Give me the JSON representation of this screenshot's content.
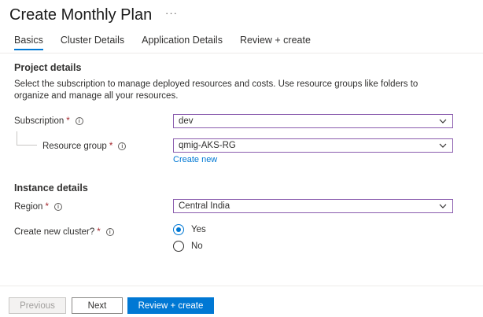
{
  "page": {
    "title": "Create Monthly Plan",
    "more_label": "···"
  },
  "tabs": [
    {
      "label": "Basics",
      "active": true
    },
    {
      "label": "Cluster Details",
      "active": false
    },
    {
      "label": "Application Details",
      "active": false
    },
    {
      "label": "Review + create",
      "active": false
    }
  ],
  "project_details": {
    "heading": "Project details",
    "description": "Select the subscription to manage deployed resources and costs. Use resource groups like folders to organize and manage all your resources.",
    "subscription": {
      "label": "Subscription",
      "required_mark": "*",
      "value": "dev"
    },
    "resource_group": {
      "label": "Resource group",
      "required_mark": "*",
      "value": "qmig-AKS-RG"
    },
    "create_new_link": "Create new"
  },
  "instance_details": {
    "heading": "Instance details",
    "region": {
      "label": "Region",
      "required_mark": "*",
      "value": "Central India"
    },
    "create_cluster": {
      "label": "Create new cluster?",
      "required_mark": "*",
      "options": [
        {
          "label": "Yes",
          "checked": true
        },
        {
          "label": "No",
          "checked": false
        }
      ]
    }
  },
  "footer": {
    "previous_label": "Previous",
    "next_label": "Next",
    "review_label": "Review + create"
  },
  "colors": {
    "accent": "#0078d4",
    "required": "#a4262c",
    "select_border": "#8a5cae"
  }
}
